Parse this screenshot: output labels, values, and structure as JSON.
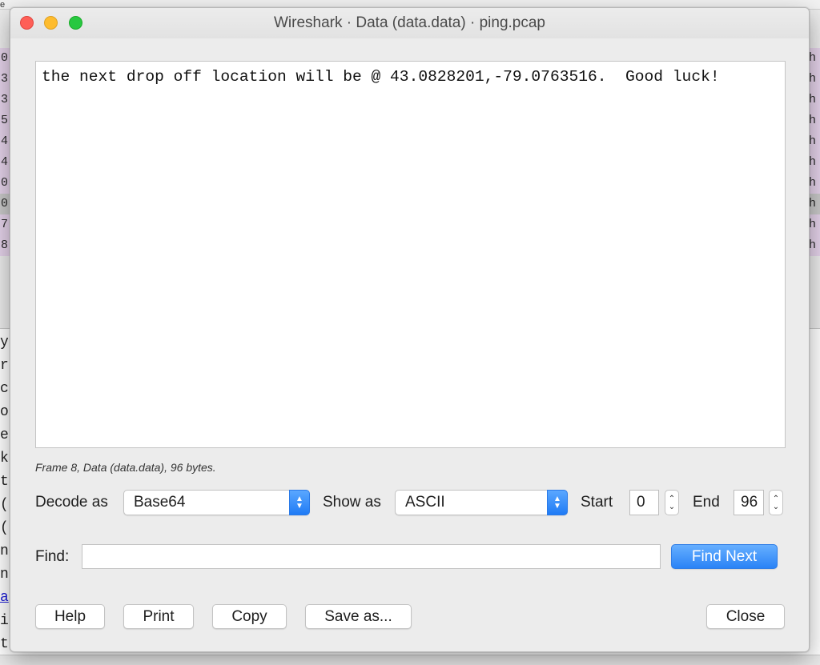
{
  "window": {
    "title": "Wireshark · Data (data.data) · ping.pcap"
  },
  "content": {
    "text": "the next drop off location will be @ 43.0828201,-79.0763516.  Good luck!"
  },
  "frame_info": "Frame 8, Data (data.data), 96 bytes.",
  "controls": {
    "decode_label": "Decode as",
    "decode_value": "Base64",
    "show_label": "Show as",
    "show_value": "ASCII",
    "start_label": "Start",
    "start_value": "0",
    "end_label": "End",
    "end_value": "96",
    "find_label": "Find:",
    "find_value": "",
    "find_next": "Find Next"
  },
  "buttons": {
    "help": "Help",
    "print": "Print",
    "copy": "Copy",
    "save_as": "Save as...",
    "close": "Close"
  },
  "background": {
    "top_text": "e",
    "list_left": [
      "0",
      "3",
      "3",
      "5",
      "4",
      "4",
      "0",
      "0",
      "7",
      "8"
    ],
    "list_right": [
      "h",
      "h",
      "h",
      "h",
      "h",
      "h",
      "h",
      "h",
      "h",
      "h"
    ],
    "detail_left": [
      "y",
      "r",
      "c",
      "o",
      "e",
      "k",
      "t",
      "(",
      "(",
      "n",
      "n",
      "a",
      "i",
      "t"
    ]
  },
  "colors": {
    "accent": "#2a83f6",
    "close": "#fe5f57",
    "minimize": "#febc2e",
    "maximize": "#28c840",
    "row_purple": "#e4d2ea",
    "row_selected": "#c9c9c9"
  }
}
